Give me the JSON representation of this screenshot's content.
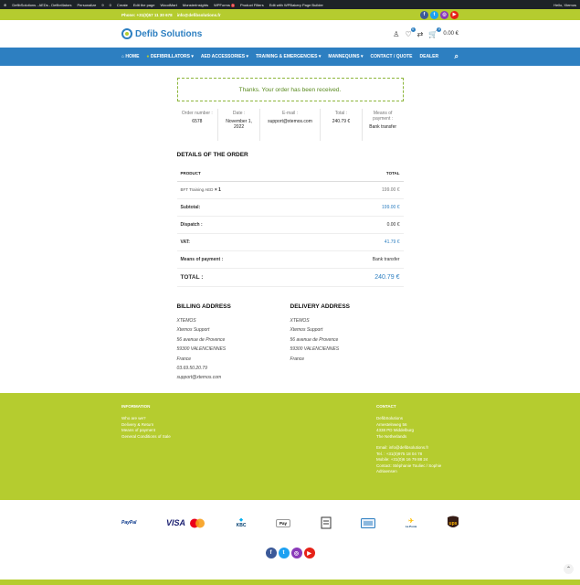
{
  "adminbar": {
    "items": [
      "DefibSolutions - AEDs - Defibrillators",
      "Personalize",
      "9",
      "0",
      "Create",
      "Edit the page",
      "WoodMart",
      "MonsterInsights",
      "WPForms",
      "Product Filters",
      "Edit with WPBakery Page Builder"
    ],
    "wpforms_count": "1",
    "greeting": "Hello, Xtemos"
  },
  "topbar": {
    "phone": "Phone: +31(0)57 11 30 678",
    "email": "info@defibsolutions.fr"
  },
  "header": {
    "logo_text": "Defib Solutions",
    "wishlist_count": "0",
    "cart_count": "0",
    "cart_total": "0.00 €"
  },
  "nav": {
    "items": [
      "Home",
      "Defibrillators",
      "AED accessories",
      "Training & Emergencies",
      "Mannequins",
      "Contact / Quote",
      "Dealer"
    ]
  },
  "order": {
    "notice": "Thanks. Your order has been received.",
    "overview": [
      {
        "label": "Order number :",
        "value": "6578"
      },
      {
        "label": "Date :",
        "value": "November 1, 2022"
      },
      {
        "label": "E-mail :",
        "value": "support@xtemos.com"
      },
      {
        "label": "Total :",
        "value": "240.79 €"
      },
      {
        "label": "Means of payment :",
        "value": "Bank transfer"
      }
    ],
    "details_title": "DETAILS OF THE ORDER",
    "col_product": "PRODUCT",
    "col_total": "TOTAL",
    "product_name": "BFT Training AED",
    "product_qty": "× 1",
    "product_total": "199.00 €",
    "rows": [
      {
        "label": "Subtotal:",
        "value": "199.00 €",
        "blue": true
      },
      {
        "label": "Dispatch :",
        "value": "0.00 €",
        "blue": false
      },
      {
        "label": "VAT:",
        "value": "41.79 €",
        "blue": true
      },
      {
        "label": "Means of payment :",
        "value": "Bank transfer",
        "blue": false
      }
    ],
    "total_label": "TOTAL :",
    "total_value": "240.79 €"
  },
  "billing": {
    "title": "BILLING ADDRESS",
    "lines": [
      "XTEMOS",
      "Xtemos Support",
      "56 avenue de Provence",
      "59300 VALENCIENNES",
      "France",
      "03.69.50.20.79",
      "support@xtemos.com"
    ]
  },
  "delivery": {
    "title": "DELIVERY ADDRESS",
    "lines": [
      "XTEMOS",
      "Xtemos Support",
      "56 avenue de Provence",
      "59300 VALENCIENNES",
      "France"
    ]
  },
  "footer": {
    "info_title": "INFORMATION",
    "info_links": [
      "Who are we?",
      "Delivery & Return",
      "Means of payment",
      "General Conditions of Sale"
    ],
    "contact_title": "CONTACT",
    "contact_address": [
      "DefibSolutions",
      "Arnestelnweg 56",
      "4338 PD Middelburg",
      "The Netherlands"
    ],
    "contact_details": [
      "Email:  info@defibsolutions.fr",
      "Tel. : +31(0)975 18 04 78",
      "Mobile: +31(0)6 16 79 88 24",
      "Contact: Stéphanie Touliec / Sophie Adriaensen"
    ]
  },
  "payments": [
    "PayPal",
    "VISA",
    "Mastercard",
    "KBC",
    "Apple Pay",
    "Bank",
    "Card",
    "La Poste",
    "UPS"
  ],
  "colors": {
    "lime": "#b5cc2f",
    "blue": "#2d7fc1",
    "facebook": "#3b5998",
    "twitter": "#1da1f2",
    "instagram": "#8a3ab9",
    "youtube": "#e62117"
  }
}
